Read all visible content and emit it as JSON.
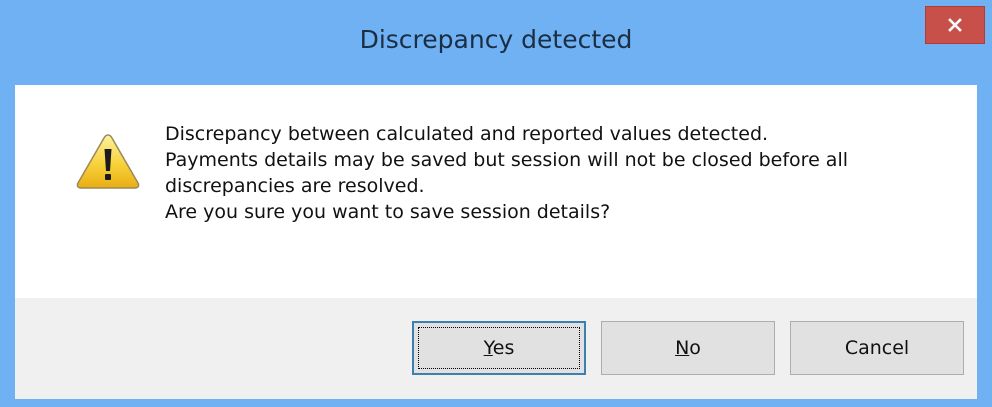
{
  "dialog": {
    "title": "Discrepancy detected",
    "close_icon": "close-icon",
    "warning_icon": "warning-icon"
  },
  "message": {
    "lines": [
      "Discrepancy between calculated and reported values detected.",
      "Payments details may be saved but session will not be closed before all",
      "discrepancies are resolved.",
      "Are you sure you want to save session details?"
    ]
  },
  "buttons": {
    "yes": {
      "mnemonic": "Y",
      "rest": "es"
    },
    "no": {
      "mnemonic": "N",
      "rest": "o"
    },
    "cancel": {
      "label": "Cancel"
    }
  },
  "colors": {
    "titlebar": "#6fb1f2",
    "close_button": "#c7504a",
    "button_area": "#f0f0f0",
    "default_button_border": "#3c7fb1"
  }
}
